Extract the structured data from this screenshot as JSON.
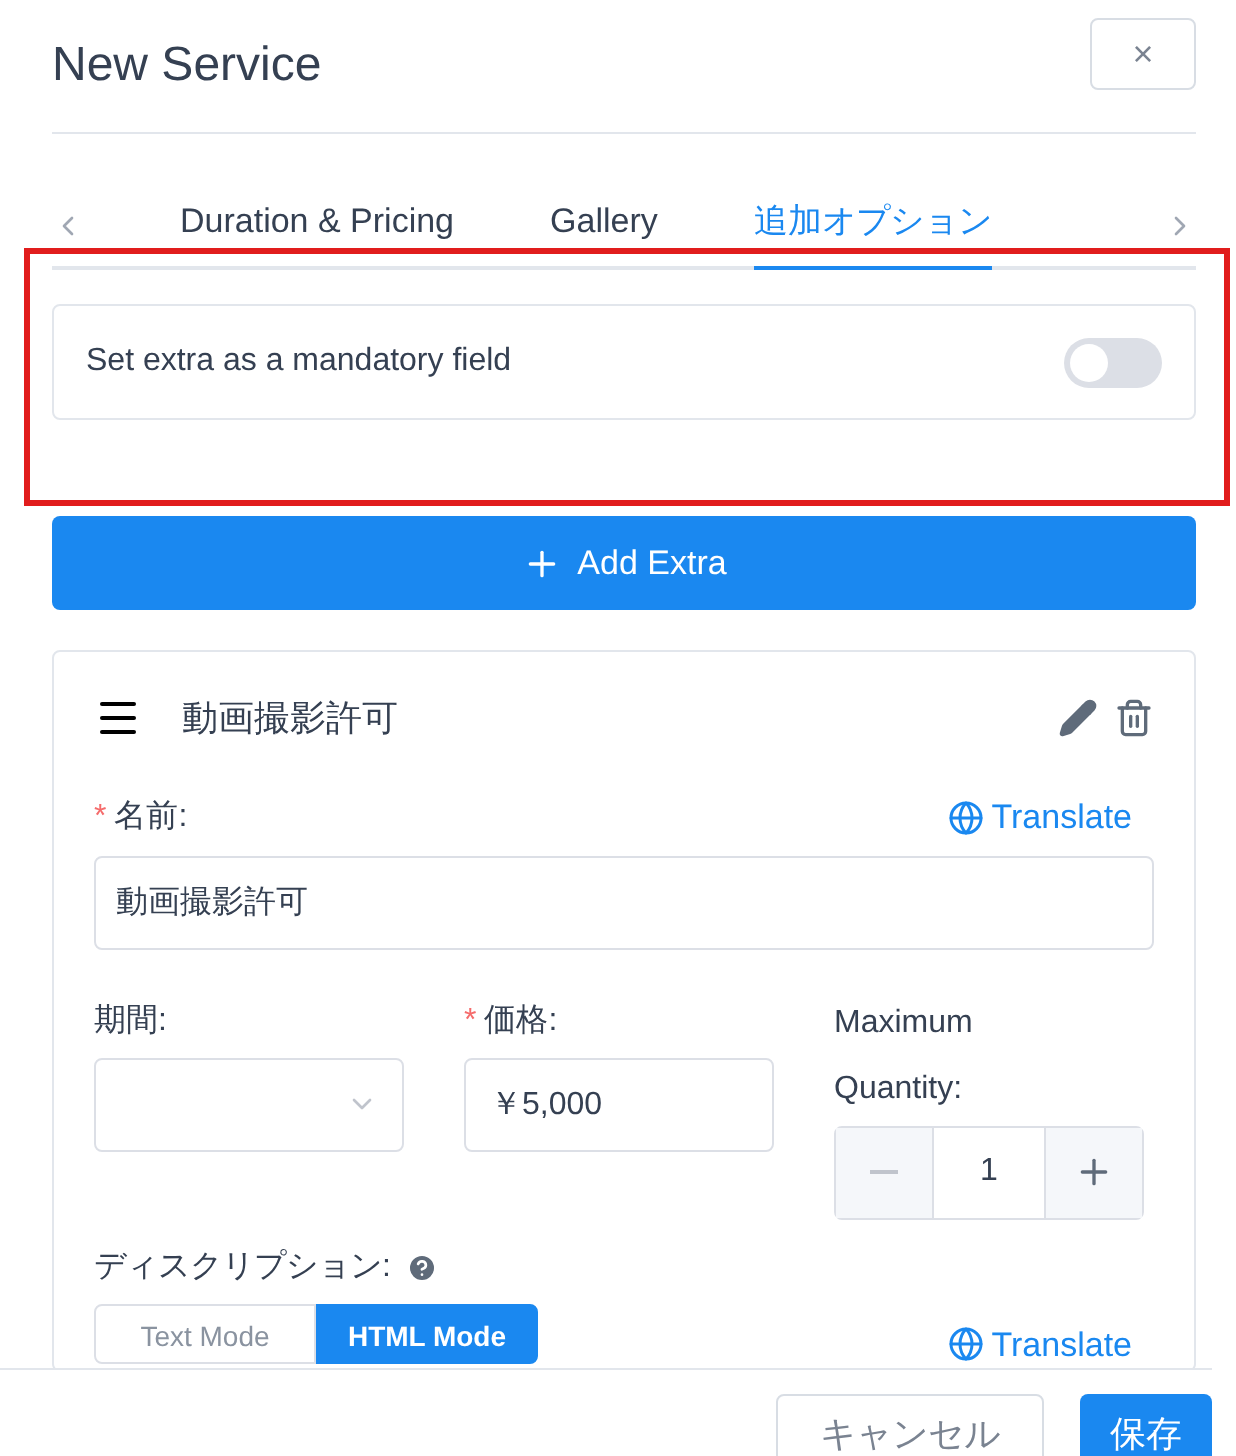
{
  "header": {
    "title": "New Service",
    "close": "×"
  },
  "tabs": [
    {
      "label": "Duration & Pricing",
      "selected": false
    },
    {
      "label": "Gallery",
      "selected": false
    },
    {
      "label": "追加オプション",
      "selected": true
    }
  ],
  "mandatory_toggle": {
    "label": "Set extra as a mandatory field",
    "on": false
  },
  "add_button": {
    "label": "Add Extra"
  },
  "extra": {
    "title": "動画撮影許可",
    "name_label": "名前:",
    "required_mark": "*",
    "name_required": true,
    "translate": "Translate",
    "name_value": "動画撮影許可",
    "duration_label": "期間:",
    "price_label": "価格:",
    "price_required": true,
    "price_value": "￥5,000",
    "quantity_label": "Maximum Quantity:",
    "quantity_value": "1",
    "description_label": "ディスクリプション:",
    "modes": [
      {
        "label": "Text Mode",
        "selected": false
      },
      {
        "label": "HTML Mode",
        "selected": true
      }
    ],
    "description_translate": "Translate"
  },
  "footer": {
    "buttons": [
      {
        "label": "キャンセル",
        "kind": "secondary"
      },
      {
        "label": "保存",
        "kind": "primary"
      }
    ]
  }
}
